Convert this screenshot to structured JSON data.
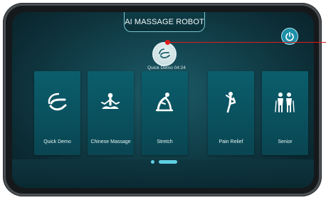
{
  "app": {
    "title": "AI MASSAGE ROBOT"
  },
  "current": {
    "label": "Quick Demo 04:24",
    "icon": "hand-icon"
  },
  "modes": [
    {
      "label": "Quick Demo",
      "icon": "hand-icon"
    },
    {
      "label": "Chinese Massage",
      "icon": "meditation-icon"
    },
    {
      "label": "Stretch",
      "icon": "stretch-pose-icon"
    },
    {
      "label": "Pain Relief",
      "icon": "leg-raise-icon"
    },
    {
      "label": "Senior",
      "icon": "elderly-couple-icon"
    }
  ],
  "pagination": {
    "pages": 2,
    "active": 2
  },
  "colors": {
    "accent": "#1a8fa8",
    "pointer": "#e01b1b",
    "card": "#0b5e6c"
  }
}
